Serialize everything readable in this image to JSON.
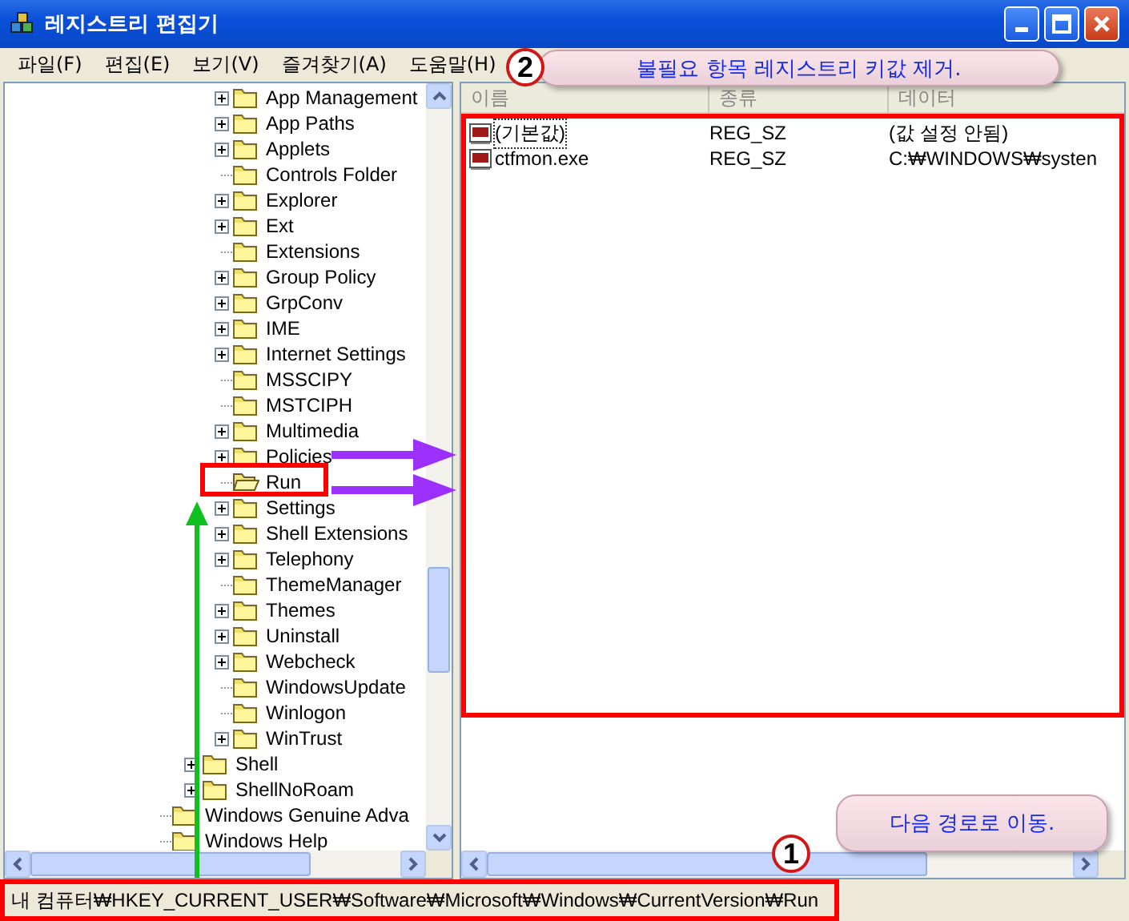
{
  "window": {
    "title": "레지스트리 편집기"
  },
  "menu": [
    "파일(F)",
    "편집(E)",
    "보기(V)",
    "즐겨찾기(A)",
    "도움말(H)"
  ],
  "tree": {
    "items": [
      {
        "children": [
          {
            "children": [
              {
                "label": "App Management",
                "expandable": true,
                "selected": false
              },
              {
                "label": "App Paths",
                "expandable": true,
                "selected": false
              },
              {
                "label": "Applets",
                "expandable": true,
                "selected": false
              },
              {
                "label": "Controls Folder",
                "expandable": false,
                "selected": false
              },
              {
                "label": "Explorer",
                "expandable": true,
                "selected": false
              },
              {
                "label": "Ext",
                "expandable": true,
                "selected": false
              },
              {
                "label": "Extensions",
                "expandable": false,
                "selected": false
              },
              {
                "label": "Group Policy",
                "expandable": true,
                "selected": false
              },
              {
                "label": "GrpConv",
                "expandable": true,
                "selected": false
              },
              {
                "label": "IME",
                "expandable": true,
                "selected": false
              },
              {
                "label": "Internet Settings",
                "expandable": true,
                "selected": false
              },
              {
                "label": "MSSCIPY",
                "expandable": false,
                "selected": false
              },
              {
                "label": "MSTCIPH",
                "expandable": false,
                "selected": false
              },
              {
                "label": "Multimedia",
                "expandable": true,
                "selected": false
              },
              {
                "label": "Policies",
                "expandable": true,
                "selected": false
              },
              {
                "label": "Run",
                "expandable": false,
                "selected": true
              },
              {
                "label": "Settings",
                "expandable": true,
                "selected": false
              },
              {
                "label": "Shell Extensions",
                "expandable": true,
                "selected": false
              },
              {
                "label": "Telephony",
                "expandable": true,
                "selected": false
              },
              {
                "label": "ThemeManager",
                "expandable": false,
                "selected": false
              },
              {
                "label": "Themes",
                "expandable": true,
                "selected": false
              },
              {
                "label": "Uninstall",
                "expandable": true,
                "selected": false
              },
              {
                "label": "Webcheck",
                "expandable": true,
                "selected": false
              },
              {
                "label": "WindowsUpdate",
                "expandable": false,
                "selected": false
              },
              {
                "label": "Winlogon",
                "expandable": false,
                "selected": false
              },
              {
                "label": "WinTrust",
                "expandable": true,
                "selected": false
              }
            ]
          },
          {
            "label": "Shell",
            "expandable": true,
            "selected": false
          },
          {
            "label": "ShellNoRoam",
            "expandable": true,
            "selected": false
          }
        ]
      },
      {
        "label": "Windows Genuine Adva",
        "expandable": false,
        "selected": false
      },
      {
        "label": "Windows Help",
        "expandable": false,
        "selected": false
      }
    ]
  },
  "list": {
    "columns": [
      "이름",
      "종류",
      "데이터"
    ],
    "rows": [
      {
        "name": "(기본값)",
        "type": "REG_SZ",
        "data": "(값 설정 안됨)",
        "focused": true
      },
      {
        "name": "ctfmon.exe",
        "type": "REG_SZ",
        "data": "C:₩WINDOWS₩systen",
        "focused": false
      }
    ]
  },
  "status_bar": {
    "path": "내 컴퓨터₩HKEY_CURRENT_USER₩Software₩Microsoft₩Windows₩CurrentVersion₩Run"
  },
  "annotations": [
    {
      "number": "2",
      "text": "불필요 항목 레지스트리 키값 제거.",
      "kind": "list"
    },
    {
      "number": "1",
      "text": "다음 경로로 이동.",
      "kind": "status"
    }
  ]
}
